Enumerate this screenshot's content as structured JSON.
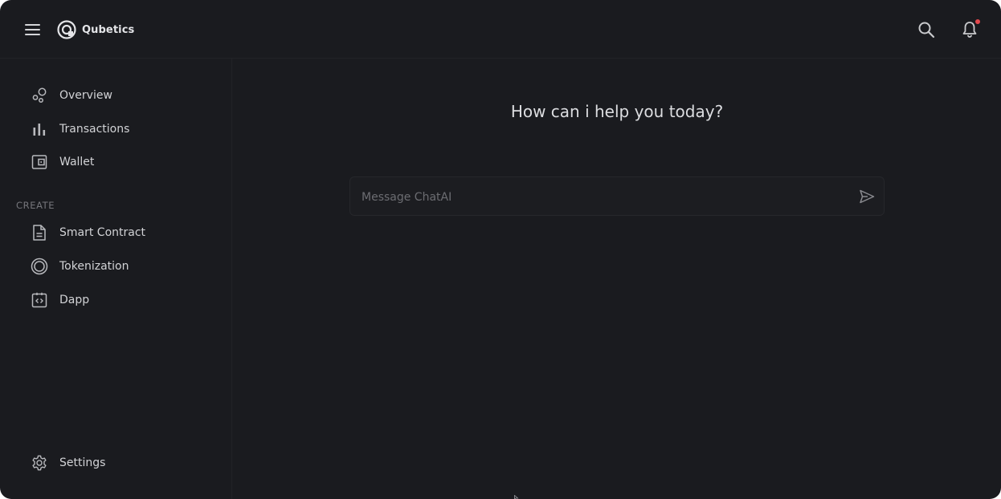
{
  "app": {
    "brand": "Qubetics",
    "logo_icon": "qubetics-logo-icon"
  },
  "header": {
    "menu_icon": "hamburger-menu-icon",
    "search_icon": "search-icon",
    "notification_icon": "bell-icon",
    "has_notification": true
  },
  "sidebar": {
    "items": [
      {
        "label": "Overview",
        "icon": "overview-icon"
      },
      {
        "label": "Transactions",
        "icon": "bar-chart-icon"
      },
      {
        "label": "Wallet",
        "icon": "wallet-icon"
      }
    ],
    "create_section_label": "CREATE",
    "create_items": [
      {
        "label": "Smart Contract",
        "icon": "document-icon"
      },
      {
        "label": "Tokenization",
        "icon": "token-icon"
      },
      {
        "label": "Dapp",
        "icon": "code-clipboard-icon"
      }
    ],
    "settings": {
      "label": "Settings",
      "icon": "gear-icon"
    }
  },
  "main": {
    "headline": "How can i help you today?",
    "chat": {
      "placeholder": "Message ChatAI",
      "value": "",
      "send_icon": "send-icon"
    }
  },
  "colors": {
    "background": "#1a1b1f",
    "text": "#d2d3d6",
    "muted": "#75767b",
    "notification_dot": "#e5484d"
  }
}
